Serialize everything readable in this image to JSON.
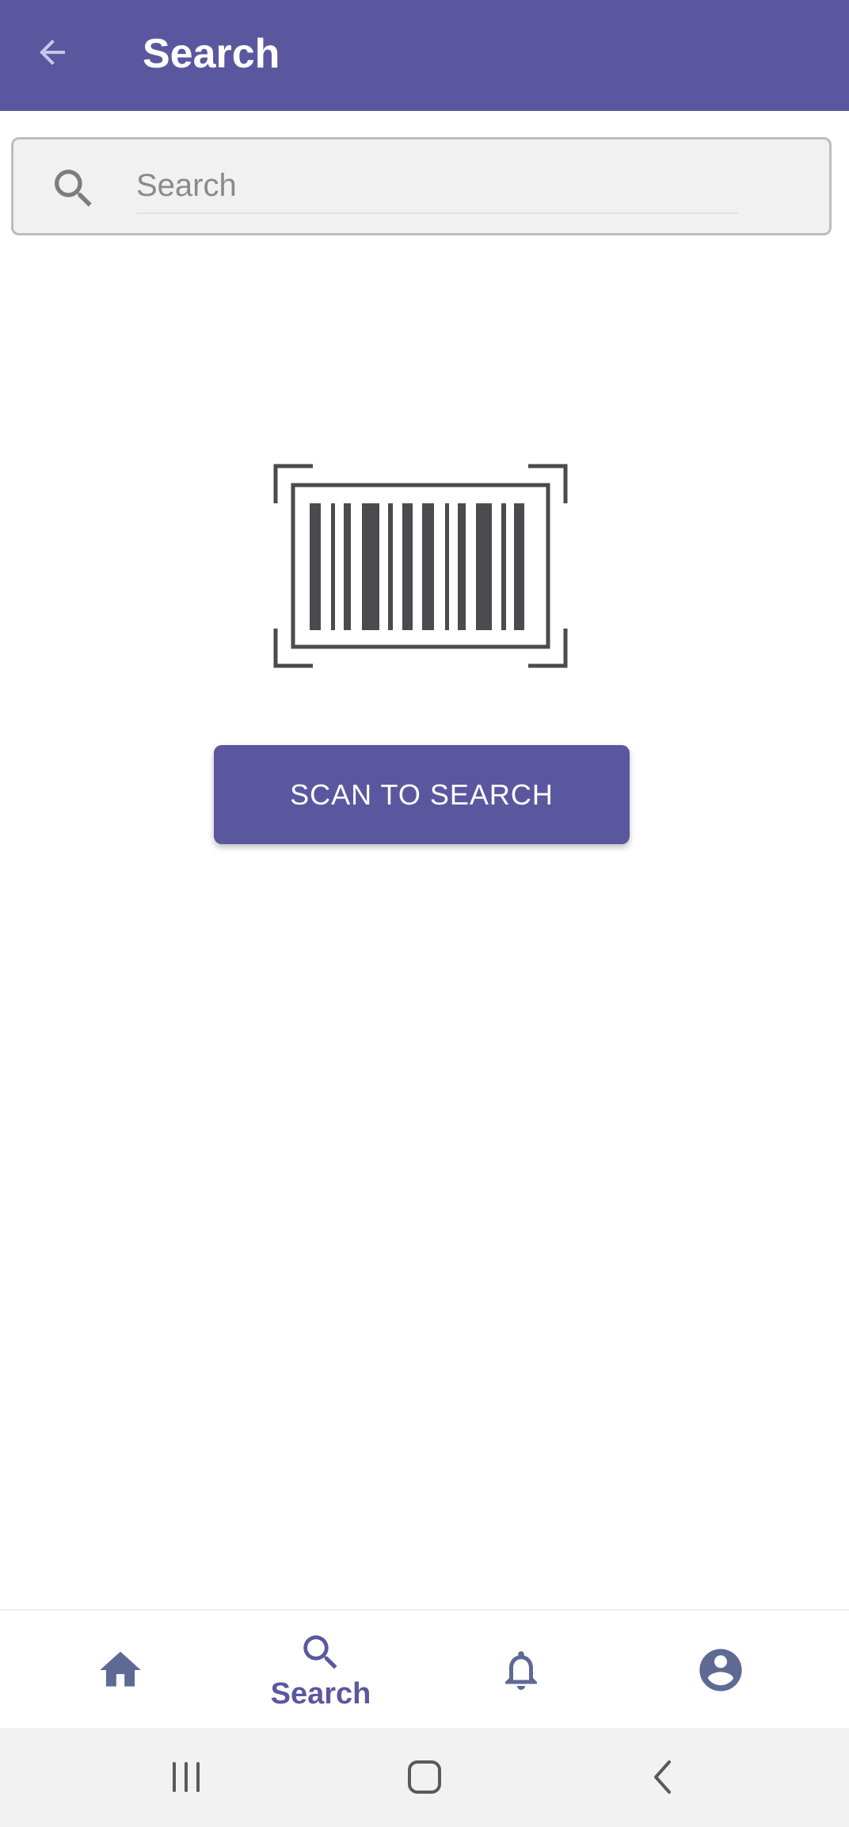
{
  "header": {
    "title": "Search",
    "back_icon": "arrow-left-icon"
  },
  "search": {
    "placeholder": "Search",
    "value": "",
    "icon": "search-icon"
  },
  "illustration": {
    "icon": "barcode-icon"
  },
  "scan_button": {
    "label": "SCAN TO SEARCH"
  },
  "bottom_nav": {
    "items": [
      {
        "icon": "home-icon",
        "label": "",
        "active": false
      },
      {
        "icon": "search-icon",
        "label": "Search",
        "active": true
      },
      {
        "icon": "bell-icon",
        "label": "",
        "active": false
      },
      {
        "icon": "account-icon",
        "label": "",
        "active": false
      }
    ]
  },
  "system_nav": {
    "items": [
      "recent-apps-icon",
      "home-button-icon",
      "back-icon"
    ]
  },
  "colors": {
    "primary": "#5b579e",
    "nav_icon": "#5f6a94",
    "barcode": "#4a4a4f",
    "search_bg": "#f1f1f1"
  }
}
